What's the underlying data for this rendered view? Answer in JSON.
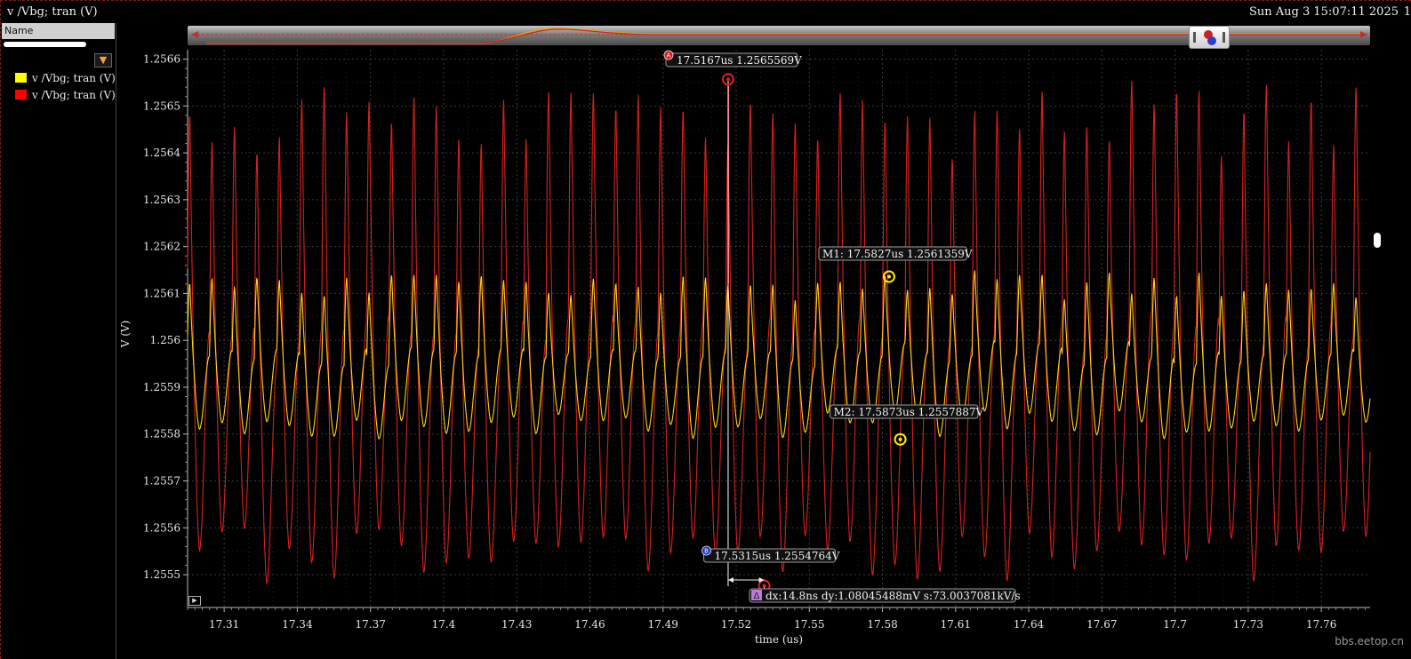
{
  "window": {
    "title": "v /Vbg; tran (V)",
    "datetime": "Sun Aug 3 15:07:11 2025",
    "datetime_extra": "1"
  },
  "sidebar": {
    "header": "Name",
    "filter_icon": "filter-icon",
    "legend": [
      {
        "label": "v /Vbg; tran (V)",
        "color": "#ffff00"
      },
      {
        "label": "v /Vbg; tran (V)",
        "color": "#ff0000"
      }
    ]
  },
  "controls": {
    "play_icon": "play-icon",
    "overview_handle_label": "Ⓐ Ⓑ"
  },
  "watermark": "bbs.eetop.cn",
  "chart_data": {
    "type": "line",
    "xlabel": "time (us)",
    "ylabel": "V (V)",
    "xlim": [
      17.295,
      17.78
    ],
    "ylim": [
      1.25543,
      1.25662
    ],
    "xticks": [
      17.31,
      17.34,
      17.37,
      17.4,
      17.43,
      17.46,
      17.49,
      17.52,
      17.55,
      17.58,
      17.61,
      17.64,
      17.67,
      17.7,
      17.73,
      17.76
    ],
    "xtick_labels": [
      "17.31",
      "17.34",
      "17.37",
      "17.4",
      "17.43",
      "17.46",
      "17.49",
      "17.52",
      "17.55",
      "17.58",
      "17.61",
      "17.64",
      "17.67",
      "17.7",
      "17.73",
      "17.76"
    ],
    "yticks": [
      1.2555,
      1.2556,
      1.2557,
      1.2558,
      1.2559,
      1.256,
      1.2561,
      1.2562,
      1.2563,
      1.2564,
      1.2565,
      1.2566
    ],
    "ytick_labels": [
      "1.2555",
      "1.2556",
      "1.2557",
      "1.2558",
      "1.2559",
      "1.256",
      "1.2561",
      "1.2562",
      "1.2563",
      "1.2564",
      "1.2565",
      "1.2566"
    ],
    "grid": true,
    "series": [
      {
        "name": "v /Vbg; tran (V)",
        "color": "#d62020",
        "period_us": 0.0092,
        "peak_min": 1.2563,
        "peak_max": 1.2565569,
        "trough_min": 1.2554764,
        "trough_max": 1.2556
      },
      {
        "name": "v /Vbg; tran (V)",
        "color": "#ffd21e",
        "period_us": 0.0092,
        "peak_min": 1.25605,
        "peak_max": 1.25615,
        "trough_min": 1.25579,
        "trough_max": 1.25585
      }
    ],
    "markers": [
      {
        "id": "A",
        "label": "17.5167us 1.2565569V",
        "x": 17.5167,
        "y": 1.2565569,
        "color": "#e02020"
      },
      {
        "id": "B",
        "label": "17.5315us 1.2554764V",
        "x": 17.5315,
        "y": 1.2554764,
        "color": "#e02020"
      },
      {
        "id": "M1",
        "label": "M1: 17.5827us 1.2561359V",
        "x": 17.5827,
        "y": 1.2561359,
        "color": "#ffee00"
      },
      {
        "id": "M2",
        "label": "M2: 17.5873us 1.2557887V",
        "x": 17.5873,
        "y": 1.2557887,
        "color": "#ffee00"
      }
    ],
    "delta": {
      "symbol": "Δ",
      "label": "dx:14.8ns dy:1.08045488mV s:73.0037081kV/s"
    }
  }
}
